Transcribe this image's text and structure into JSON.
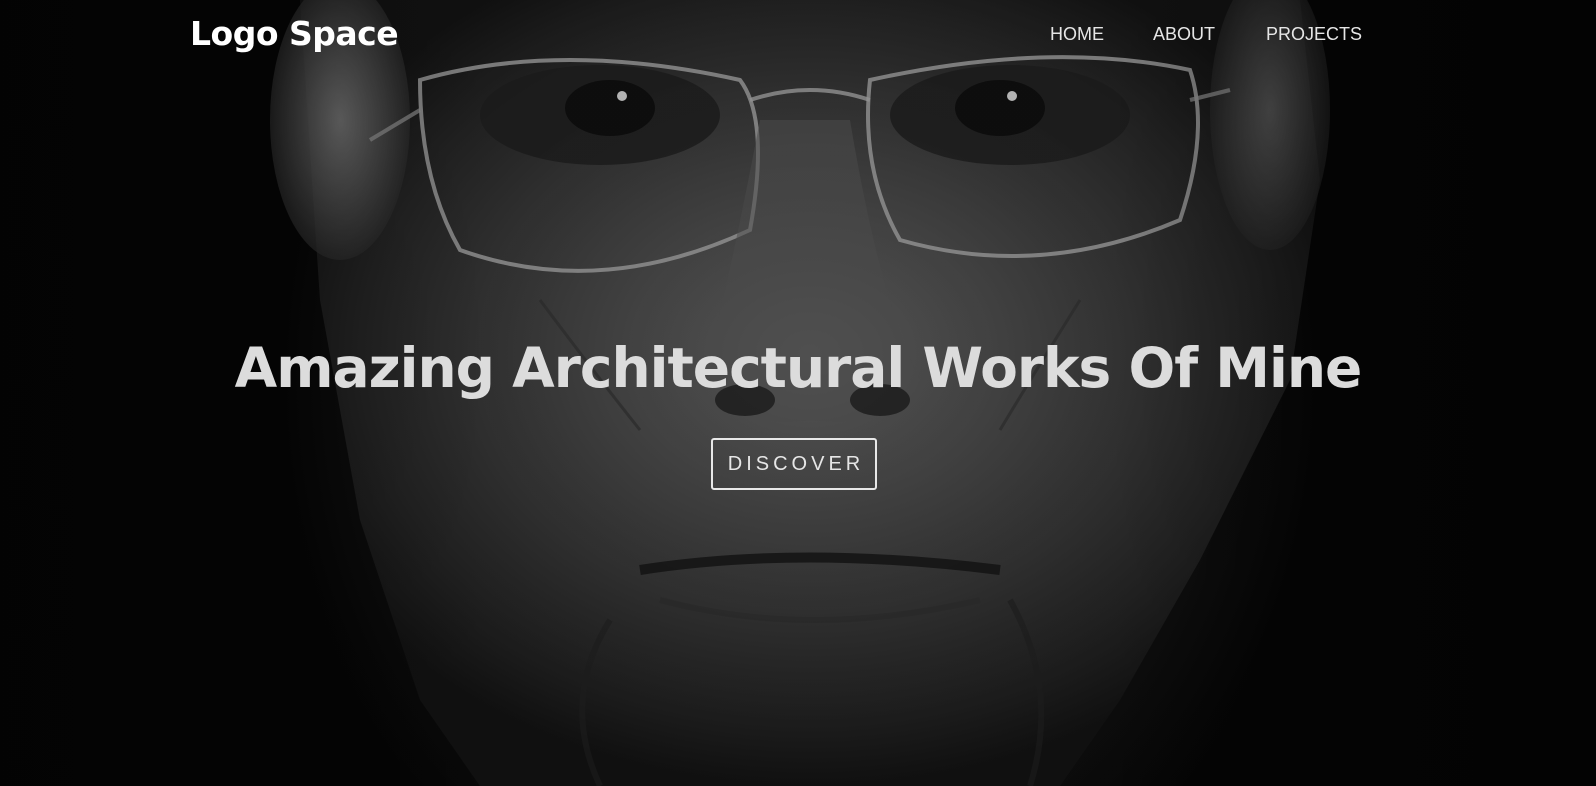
{
  "brand": {
    "logo_text": "Logo Space"
  },
  "nav": {
    "items": [
      {
        "label": "HOME"
      },
      {
        "label": "ABOUT"
      },
      {
        "label": "PROJECTS"
      }
    ]
  },
  "hero": {
    "headline": "Amazing Architectural Works Of Mine",
    "cta_label": "DISCOVER",
    "background_image": "grayscale-portrait-of-man-with-glasses"
  },
  "colors": {
    "background": "#050505",
    "text": "#ffffff",
    "headline": "#dcdcdc",
    "button_border": "#e8e8e8"
  }
}
